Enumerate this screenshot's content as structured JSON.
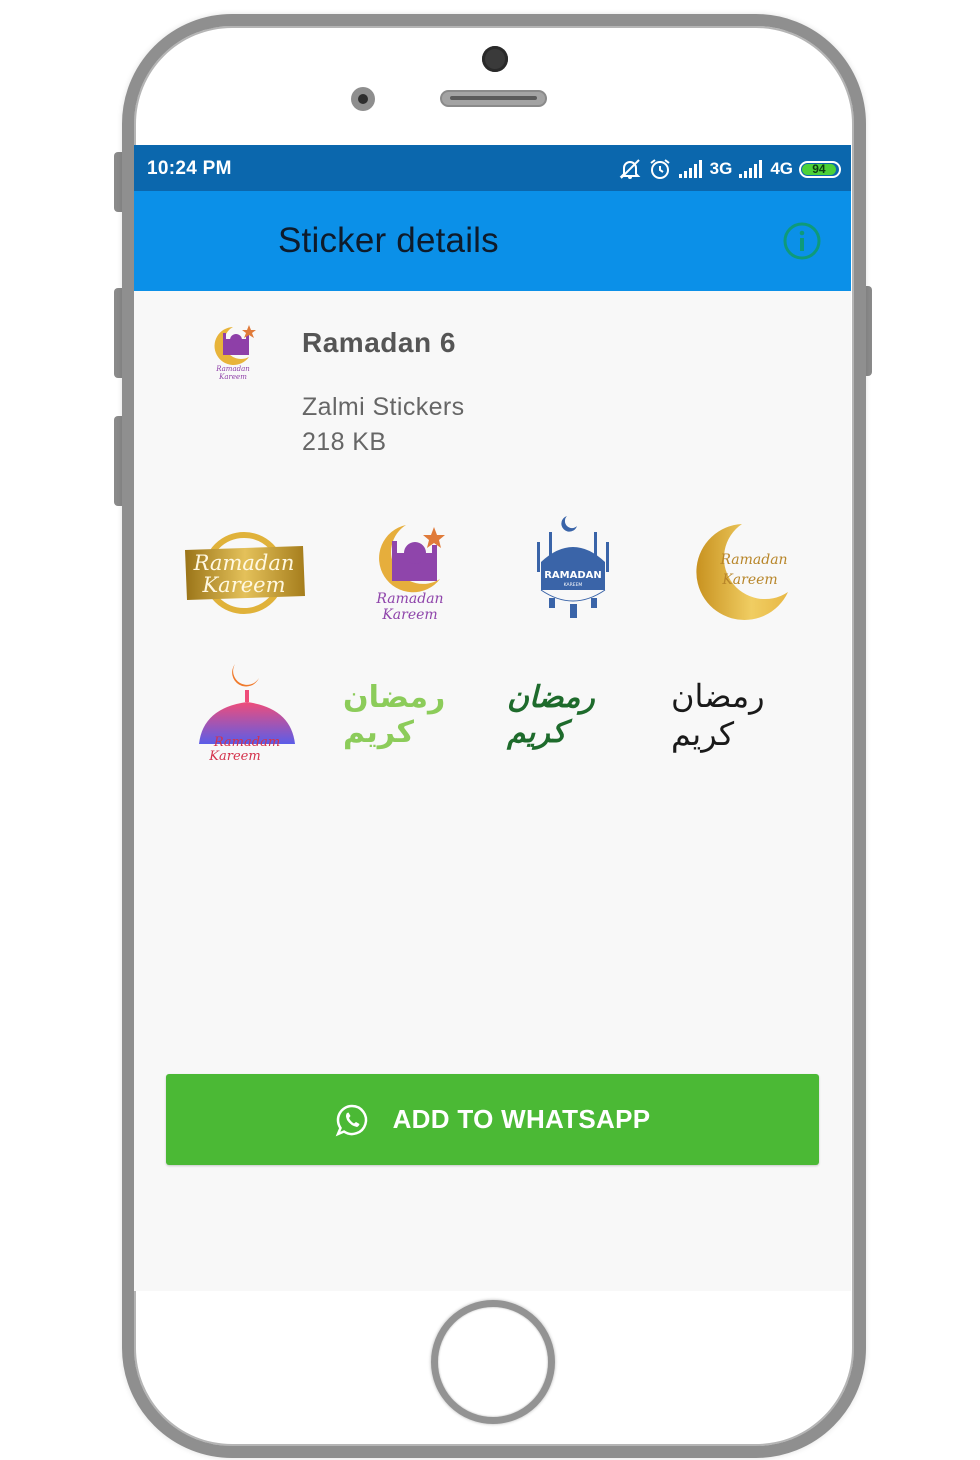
{
  "status_bar": {
    "time": "10:24 PM",
    "icons": [
      "bell-off-icon",
      "alarm-icon",
      "signal-icon",
      "signal-icon"
    ],
    "network_1": "3G",
    "network_2": "4G",
    "battery": "94"
  },
  "app_bar": {
    "title": "Sticker details",
    "info_icon": "info-icon",
    "colors": {
      "background": "#0b90e8",
      "status": "#0b67ad",
      "info": "#0e9a7a"
    }
  },
  "pack": {
    "name": "Ramadan 6",
    "publisher": "Zalmi Stickers",
    "size": "218 KB",
    "tray_icon_caption": "Ramadan Kareem"
  },
  "stickers": [
    {
      "id": "gold-brush",
      "caption_1": "Ramadan",
      "caption_2": "Kareem"
    },
    {
      "id": "purple-mosque-crescent",
      "caption_1": "Ramadan",
      "caption_2": "Kareem"
    },
    {
      "id": "blue-mosque-lanterns",
      "caption_1": "RAMADAN",
      "caption_2": "KAREEM"
    },
    {
      "id": "gold-crescent",
      "caption_1": "Ramadan",
      "caption_2": "Kareem"
    },
    {
      "id": "gradient-dome",
      "caption_1": "Ramadam",
      "caption_2": "Kareem"
    },
    {
      "id": "green-arabic-calligraphy",
      "caption_1": "رمضان كريم"
    },
    {
      "id": "dark-green-arabic-calligraphy",
      "caption_1": "رمضان كريم"
    },
    {
      "id": "black-arabic-calligraphy",
      "caption_1": "رمضان كريم"
    }
  ],
  "action": {
    "label": "ADD TO WHATSAPP",
    "icon": "whatsapp-icon",
    "color": "#4bb935"
  }
}
